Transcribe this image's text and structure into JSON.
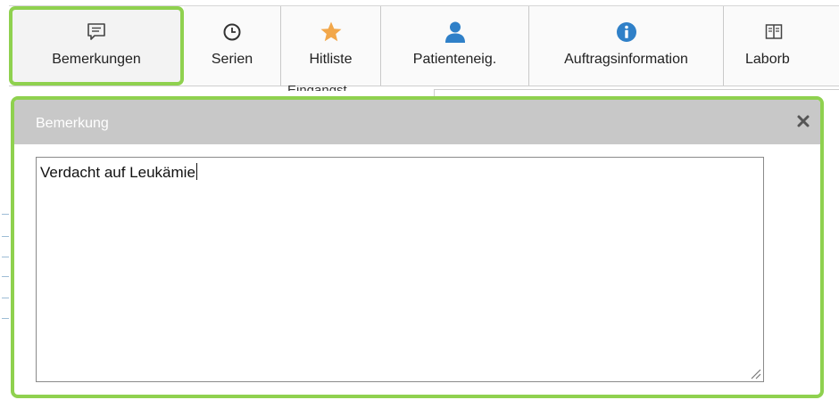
{
  "theme": {
    "highlight": "#8fd14f",
    "icon_blue": "#2f80c8",
    "star": "#f2a74a"
  },
  "toolbar": {
    "buttons": [
      {
        "label": "Bemerkungen",
        "icon": "comment-icon"
      },
      {
        "label": "Serien",
        "icon": "clock-icon"
      },
      {
        "label": "Hitliste",
        "icon": "star-icon"
      },
      {
        "label": "Patienteneig.",
        "icon": "person-icon"
      },
      {
        "label": "Auftragsinformation",
        "icon": "info-icon"
      },
      {
        "label": "Laborb",
        "icon": "book-icon"
      }
    ]
  },
  "background": {
    "label_partial": "Eingangst"
  },
  "dialog": {
    "title": "Bemerkung",
    "close_icon": "close-icon",
    "text": "Verdacht auf Leukämie"
  }
}
